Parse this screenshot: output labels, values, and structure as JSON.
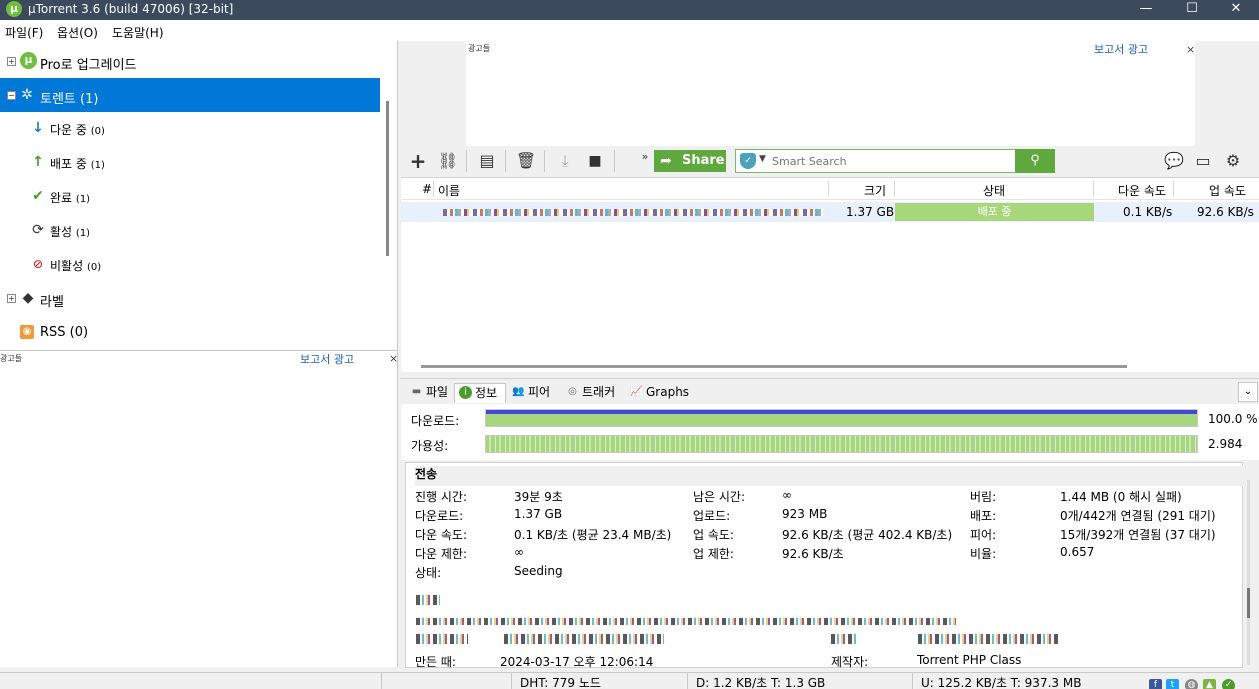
{
  "window": {
    "title": "µTorrent 3.6  (build 47006) [32-bit]",
    "minimize_glyph": "—",
    "maximize_glyph": "☐",
    "close_glyph": "✕"
  },
  "menu": {
    "file": "파일(F)",
    "options": "옵션(O)",
    "help": "도움말(H)"
  },
  "sidebar": {
    "pro": "Pro로 업그레이드",
    "torrents": "토렌트 (1)",
    "downloading": "다운 중",
    "downloading_count": "(0)",
    "seeding": "배포 중",
    "seeding_count": "(1)",
    "completed": "완료",
    "completed_count": "(1)",
    "active": "활성",
    "active_count": "(1)",
    "inactive": "비활성",
    "inactive_count": "(0)",
    "labels": "라벨",
    "rss": "RSS (0)"
  },
  "ads": {
    "label": "광고들",
    "report": "보고서 광고",
    "close": "×"
  },
  "toolbar": {
    "share": "Share",
    "search_placeholder": "Smart Search",
    "more": "»"
  },
  "list": {
    "columns": {
      "num": "#",
      "name": "이름",
      "size": "크기",
      "status": "상태",
      "down_speed": "다운 속도",
      "up_speed": "업 속도"
    },
    "row": {
      "size": "1.37 GB",
      "status": "배포 중",
      "status_color": "#a7d77a",
      "down_speed": "0.1 KB/s",
      "up_speed": "92.6 KB/s"
    }
  },
  "tabs": {
    "files": "파일",
    "info": "정보",
    "peers": "피어",
    "trackers": "트래커",
    "graphs": "Graphs"
  },
  "progress": {
    "download_label": "다운로드:",
    "download_value": "100.0 %",
    "download_fraction": 1.0,
    "availability_label": "가용성:",
    "availability_value": "2.984"
  },
  "transfer": {
    "section": "전송",
    "elapsed_k": "진행 시간:",
    "elapsed_v": "39분 9초",
    "downloaded_k": "다운로드:",
    "downloaded_v": "1.37 GB",
    "down_speed_k": "다운 속도:",
    "down_speed_v": "0.1 KB/초 (평균 23.4 MB/초)",
    "down_limit_k": "다운 제한:",
    "down_limit_v": "∞",
    "status_k": "상태:",
    "status_v": "Seeding",
    "remaining_k": "남은 시간:",
    "remaining_v": "∞",
    "uploaded_k": "업로드:",
    "uploaded_v": "923 MB",
    "up_speed_k": "업 속도:",
    "up_speed_v": "92.6 KB/초 (평균 402.4 KB/초)",
    "up_limit_k": "업 제한:",
    "up_limit_v": "92.6 KB/초",
    "wasted_k": "버림:",
    "wasted_v": "1.44 MB (0 해시 실패)",
    "seeds_k": "배포:",
    "seeds_v": "0개/442개 연결됨 (291 대기)",
    "peers_k": "피어:",
    "peers_v": "15개/392개 연결됨 (37 대기)",
    "ratio_k": "비율:",
    "ratio_v": "0.657",
    "created_k": "만든 때:",
    "created_v": "2024-03-17 오후 12:06:14",
    "creator_k": "제작자:",
    "creator_v": "Torrent PHP Class"
  },
  "statusbar": {
    "dht": "DHT: 779 노드",
    "down": "D: 1.2 KB/초 T: 1.3 GB",
    "up": "U: 125.2 KB/초 T: 937.3 MB"
  }
}
